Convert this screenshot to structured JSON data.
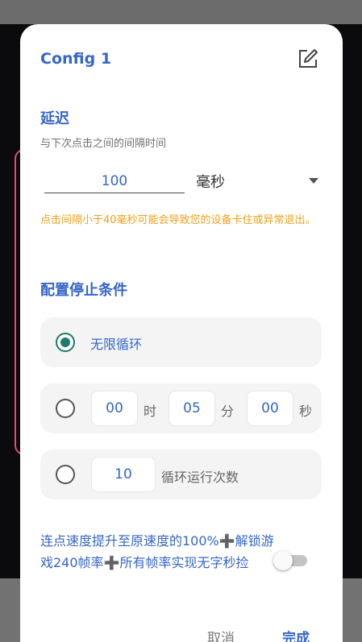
{
  "dialog": {
    "title": "Config 1",
    "delay": {
      "section_title": "延迟",
      "subtitle": "与下次点击之间的间隔时间",
      "value": "100",
      "unit": "毫秒",
      "warning": "点击间隔小于40毫秒可能会导致您的设备卡住或异常退出。"
    },
    "stop_conditions": {
      "section_title": "配置停止条件",
      "infinite_label": "无限循环",
      "timer": {
        "hours": "00",
        "hours_unit": "时",
        "minutes": "05",
        "minutes_unit": "分",
        "seconds": "00",
        "seconds_unit": "秒"
      },
      "cycles": {
        "value": "10",
        "label": "循环运行次数"
      }
    },
    "promo": {
      "part1": "连点速度提升至原速度的100%",
      "plus": "➕",
      "part2": "解锁游戏240帧率",
      "part3": "所有帧率实现无字秒捡",
      "toggle_on": false
    },
    "buttons": {
      "cancel": "取消",
      "done": "完成"
    }
  },
  "colors": {
    "accent_blue": "#3566c9",
    "warning_orange": "#f0a21a",
    "radio_green": "#1d7a6c",
    "plus_yellow": "#f2c21b"
  },
  "icons": {
    "edit": "edit-icon",
    "dropdown": "chevron-down-icon"
  }
}
